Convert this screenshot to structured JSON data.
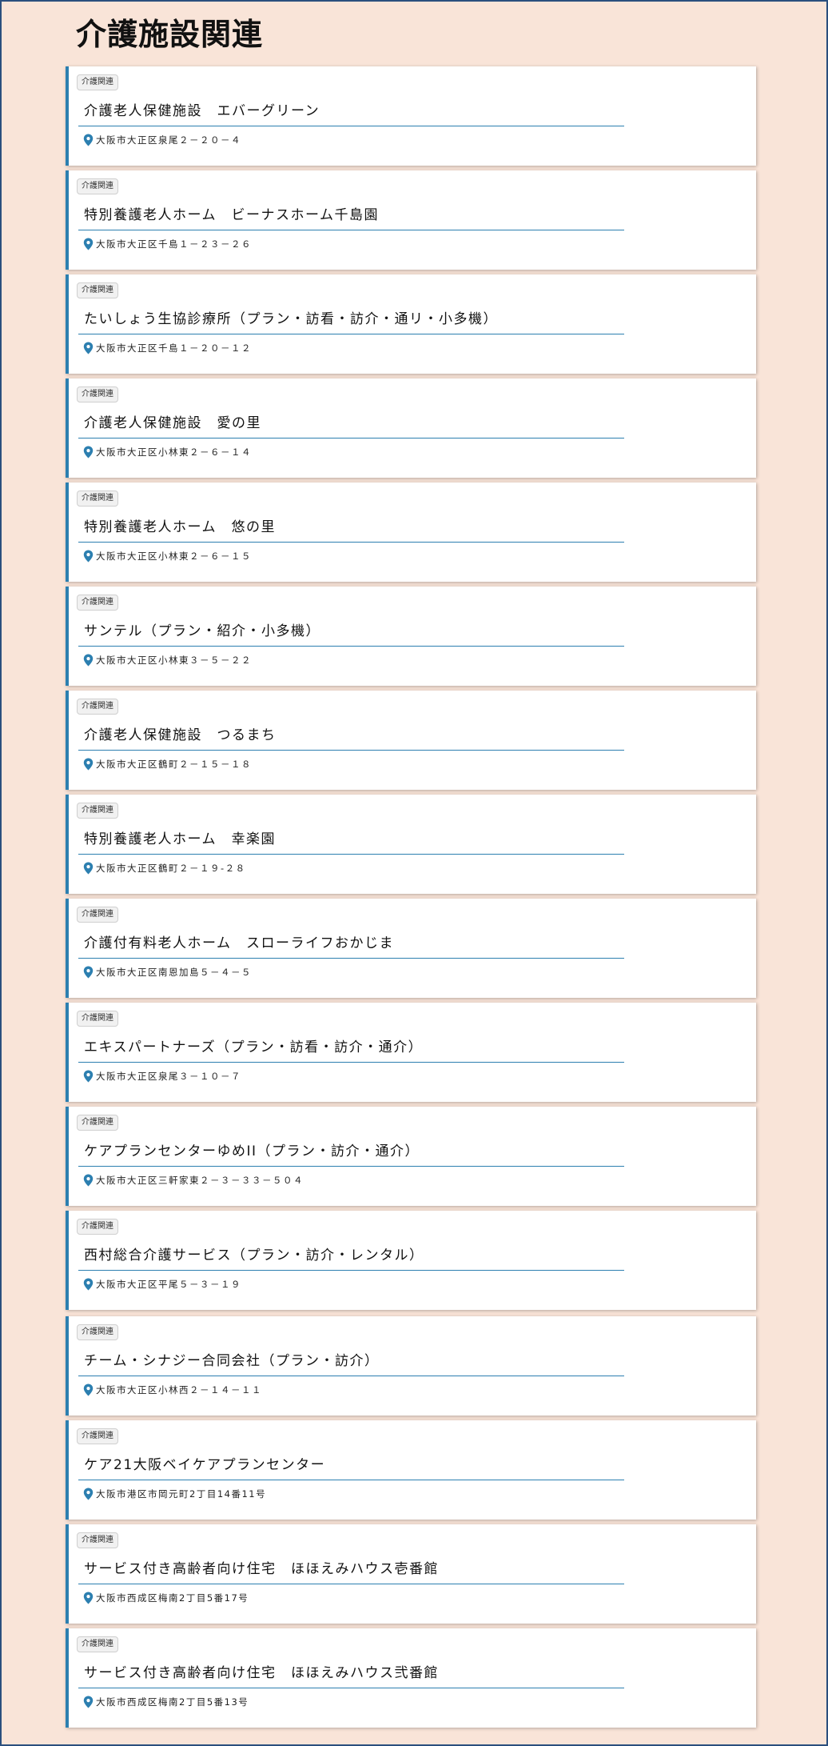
{
  "page": {
    "title": "介護施設関連"
  },
  "colors": {
    "accent": "#2c7fb0",
    "background": "#f9e4d8",
    "frame": "#2b4f7e"
  },
  "icons": {
    "location": "map-pin-icon"
  },
  "items": [
    {
      "category": "介護関連",
      "name": "介護老人保健施設　エバーグリーン",
      "address": "大阪市大正区泉尾２－２０－４"
    },
    {
      "category": "介護関連",
      "name": "特別養護老人ホーム　ビーナスホーム千島園",
      "address": "大阪市大正区千島１－２３－２６"
    },
    {
      "category": "介護関連",
      "name": "たいしょう生協診療所（プラン・訪看・訪介・通リ・小多機）",
      "address": "大阪市大正区千島１－２０－１２"
    },
    {
      "category": "介護関連",
      "name": "介護老人保健施設　愛の里",
      "address": "大阪市大正区小林東２－６－１４"
    },
    {
      "category": "介護関連",
      "name": "特別養護老人ホーム　悠の里",
      "address": "大阪市大正区小林東２－６－１５"
    },
    {
      "category": "介護関連",
      "name": "サンテル（プラン・紹介・小多機）",
      "address": "大阪市大正区小林東３－５－２２"
    },
    {
      "category": "介護関連",
      "name": "介護老人保健施設　つるまち",
      "address": "大阪市大正区鶴町２－１５－１８"
    },
    {
      "category": "介護関連",
      "name": "特別養護老人ホーム　幸楽園",
      "address": "大阪市大正区鶴町２－１９-２８"
    },
    {
      "category": "介護関連",
      "name": "介護付有料老人ホーム　スローライフおかじま",
      "address": "大阪市大正区南恩加島５－４－５"
    },
    {
      "category": "介護関連",
      "name": "エキスパートナーズ（プラン・訪看・訪介・通介）",
      "address": "大阪市大正区泉尾３－１０－７"
    },
    {
      "category": "介護関連",
      "name": "ケアプランセンターゆめII（プラン・訪介・通介）",
      "address": "大阪市大正区三軒家東２－３－３３－５０４"
    },
    {
      "category": "介護関連",
      "name": "西村総合介護サービス（プラン・訪介・レンタル）",
      "address": "大阪市大正区平尾５－３－１９"
    },
    {
      "category": "介護関連",
      "name": "チーム・シナジー合同会社（プラン・訪介）",
      "address": "大阪市大正区小林西２－１４－１１"
    },
    {
      "category": "介護関連",
      "name": "ケア21大阪ベイケアプランセンター",
      "address": "大阪市港区市岡元町2丁目14番11号"
    },
    {
      "category": "介護関連",
      "name": "サービス付き高齢者向け住宅　ほほえみハウス壱番館",
      "address": "大阪市西成区梅南2丁目5番17号"
    },
    {
      "category": "介護関連",
      "name": "サービス付き高齢者向け住宅　ほほえみハウス弐番館",
      "address": "大阪市西成区梅南2丁目5番13号"
    }
  ]
}
